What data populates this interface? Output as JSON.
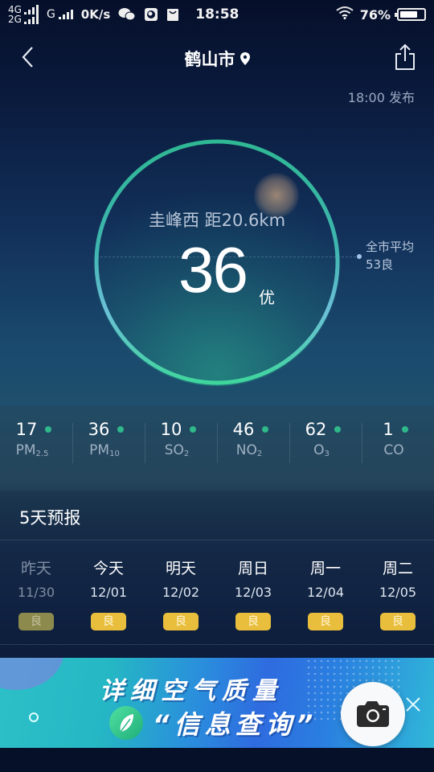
{
  "status_bar": {
    "network1": "4G",
    "network2": "2G",
    "network3": "G",
    "speed": "0K/s",
    "time": "18:58",
    "battery": "76%",
    "battery_level": 0.76,
    "icons": [
      "signal-icon",
      "wechat-icon",
      "browser-icon",
      "shopping-icon",
      "wifi-icon",
      "battery-icon"
    ]
  },
  "header": {
    "title": "鹤山市",
    "back_icon": "chevron-left-icon",
    "location_icon": "location-pin-icon",
    "share_icon": "share-icon"
  },
  "publish_time": "18:00 发布",
  "aqi": {
    "station": "圭峰西 距20.6km",
    "value": "36",
    "level": "优",
    "ring_color": "#3ad29c",
    "city_avg_label": "全市平均",
    "city_avg_value": "53良"
  },
  "pollutants": [
    {
      "value": "17",
      "name": "PM",
      "sub": "2.5",
      "status_color": "#2fb88a"
    },
    {
      "value": "36",
      "name": "PM",
      "sub": "10",
      "status_color": "#2fb88a"
    },
    {
      "value": "10",
      "name": "SO",
      "sub": "2",
      "status_color": "#2fb88a"
    },
    {
      "value": "46",
      "name": "NO",
      "sub": "2",
      "status_color": "#2fb88a"
    },
    {
      "value": "62",
      "name": "O",
      "sub": "3",
      "status_color": "#2fb88a"
    },
    {
      "value": "1",
      "name": "CO",
      "sub": "",
      "status_color": "#2fb88a"
    }
  ],
  "forecast": {
    "title": "5天预报",
    "days": [
      {
        "name": "昨天",
        "date": "11/30",
        "level": "良",
        "past": true
      },
      {
        "name": "今天",
        "date": "12/01",
        "level": "良",
        "past": false
      },
      {
        "name": "明天",
        "date": "12/02",
        "level": "良",
        "past": false
      },
      {
        "name": "周日",
        "date": "12/03",
        "level": "良",
        "past": false
      },
      {
        "name": "周一",
        "date": "12/04",
        "level": "良",
        "past": false
      },
      {
        "name": "周二",
        "date": "12/05",
        "level": "良",
        "past": false
      }
    ],
    "level_color": "#e9be3c"
  },
  "banner": {
    "line1": "详细空气质量",
    "line2": "“信息查询”",
    "close_icon": "close-icon",
    "leaf_icon": "leaf-icon"
  },
  "camera_button": {
    "icon": "camera-icon"
  }
}
